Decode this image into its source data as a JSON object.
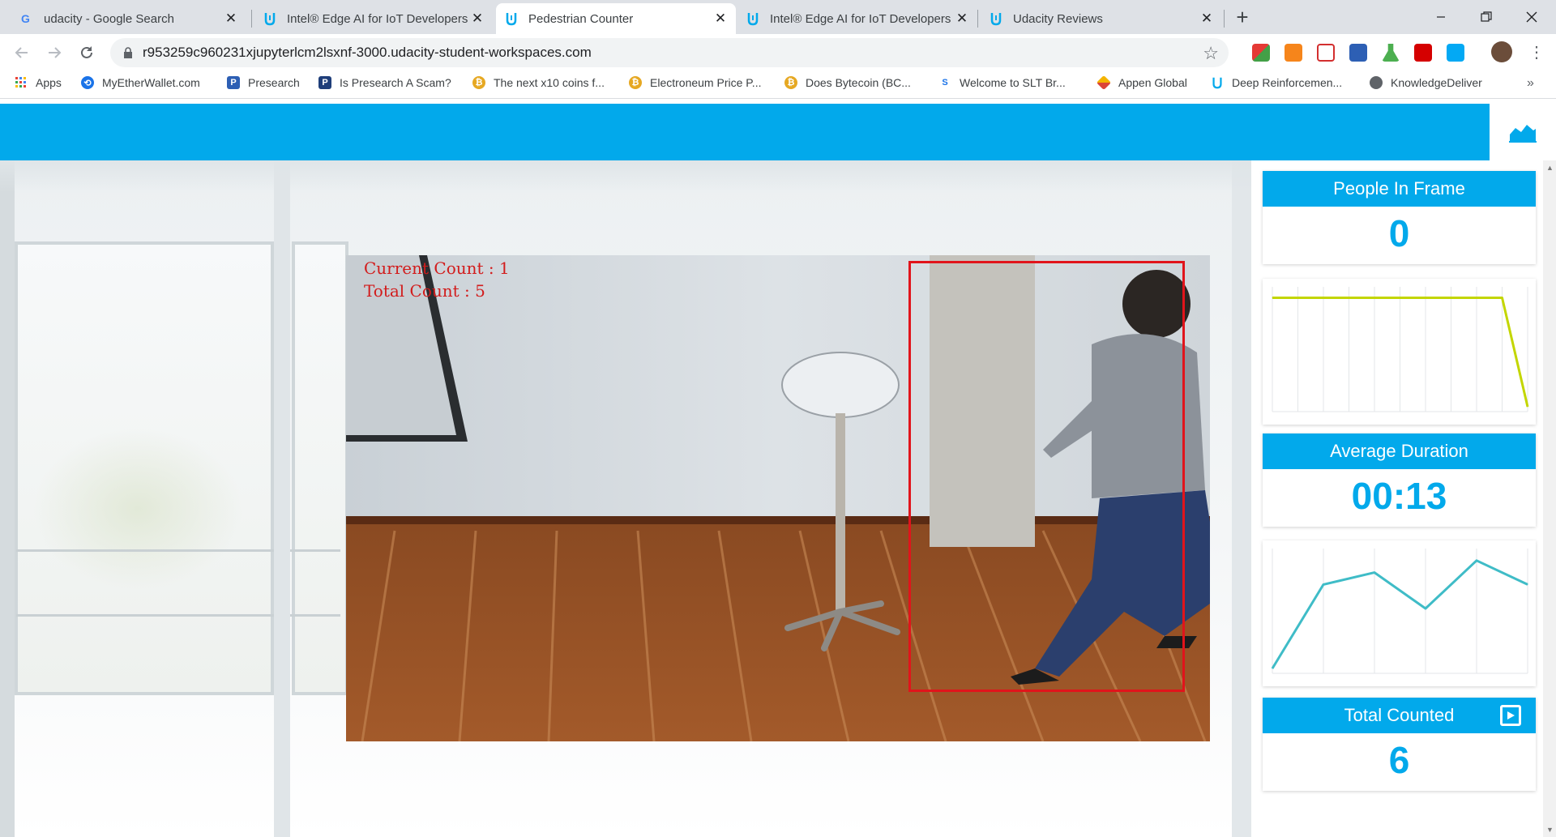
{
  "browser": {
    "tabs": [
      {
        "title": "udacity - Google Search",
        "icon": "google-icon",
        "active": false
      },
      {
        "title": "Intel® Edge AI for IoT Developers",
        "icon": "udacity-icon",
        "active": false
      },
      {
        "title": "Pedestrian Counter",
        "icon": "udacity-icon",
        "active": true
      },
      {
        "title": "Intel® Edge AI for IoT Developers",
        "icon": "udacity-icon",
        "active": false
      },
      {
        "title": "Udacity Reviews",
        "icon": "udacity-icon",
        "active": false
      }
    ],
    "url": "r953259c960231xjupyterlcm2lsxnf-3000.udacity-student-workspaces.com",
    "bookmarks": [
      {
        "label": "Apps",
        "icon": "apps-grid-icon",
        "color": "#ea4335"
      },
      {
        "label": "MyEtherWallet.com",
        "icon": "myetherwallet-icon",
        "color": "#1a73e8"
      },
      {
        "label": "Presearch",
        "icon": "presearch-icon",
        "color": "#2d5fb4"
      },
      {
        "label": "Is Presearch A Scam?",
        "icon": "presearch-icon",
        "color": "#1f3e7a"
      },
      {
        "label": "The next x10 coins f...",
        "icon": "coin-icon",
        "color": "#e6a822"
      },
      {
        "label": "Electroneum Price P...",
        "icon": "coin-icon",
        "color": "#e6a822"
      },
      {
        "label": "Does Bytecoin (BC...",
        "icon": "coin-icon",
        "color": "#e6a822"
      },
      {
        "label": "Welcome to SLT Br...",
        "icon": "slt-icon",
        "color": "#1a73e8"
      },
      {
        "label": "Appen Global",
        "icon": "appen-icon",
        "color": "#f4b400"
      },
      {
        "label": "Deep Reinforcemen...",
        "icon": "udacity-icon",
        "color": "#02a9eb"
      },
      {
        "label": "KnowledgeDeliver",
        "icon": "globe-icon",
        "color": "#5f6368"
      }
    ]
  },
  "app": {
    "accent": "#02a9eb",
    "video_overlay": {
      "current_count": "Current Count : 1",
      "total_count": "Total Count : 5"
    },
    "cards": {
      "people_in_frame": {
        "label": "People In Frame",
        "value": "0"
      },
      "average_duration": {
        "label": "Average Duration",
        "value": "00:13"
      },
      "total_counted": {
        "label": "Total Counted",
        "value": "6"
      }
    }
  },
  "chart_data": [
    {
      "type": "line",
      "x": [
        1,
        2,
        3,
        4,
        5,
        6,
        7,
        8,
        9,
        10,
        11
      ],
      "values": [
        1,
        1,
        1,
        1,
        1,
        1,
        1,
        1,
        1,
        1,
        0
      ],
      "ylim": [
        0,
        1.1
      ],
      "color": "#c3d600",
      "grid": "vertical"
    },
    {
      "type": "line",
      "x": [
        1,
        2,
        3,
        4,
        5,
        6
      ],
      "values": [
        0,
        7,
        8,
        5,
        9,
        7
      ],
      "ylim": [
        0,
        10
      ],
      "color": "#3fbcc7",
      "grid": "vertical"
    }
  ]
}
